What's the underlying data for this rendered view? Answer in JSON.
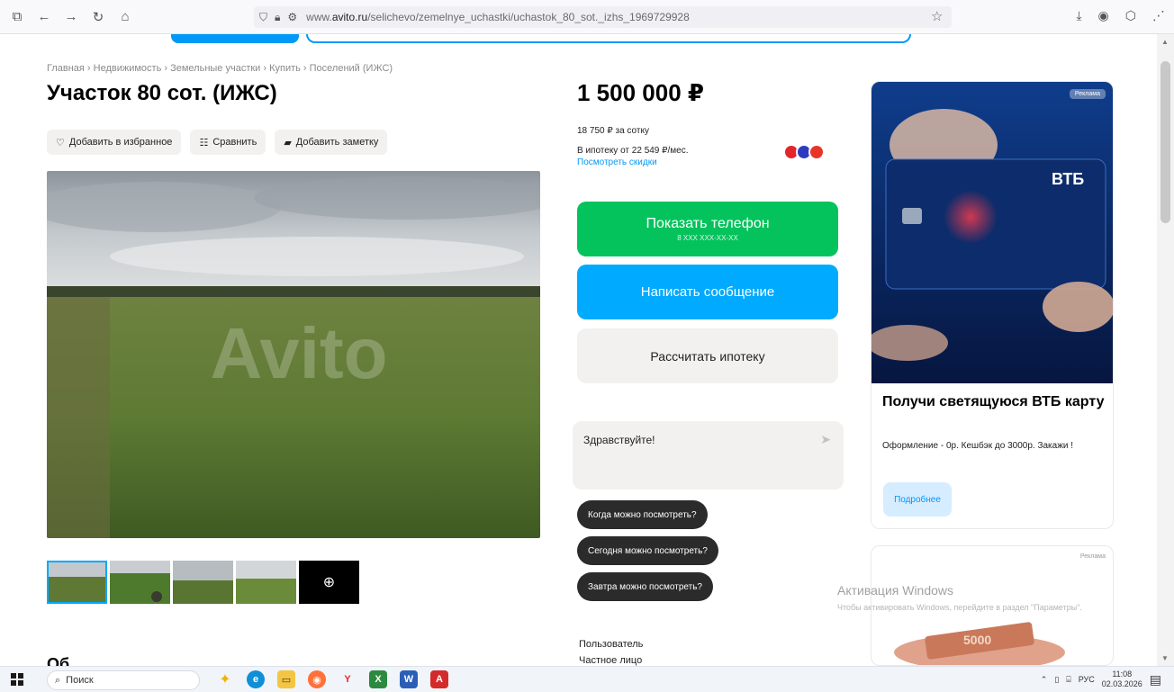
{
  "browser": {
    "url_prefix": "www.",
    "url_domain": "avito.ru",
    "url_path": "/selichevo/zemelnye_uchastki/uchastok_80_sot._izhs_1969729928"
  },
  "breadcrumbs": "Главная › Недвижимость › Земельные участки › Купить › Поселений (ИЖС)",
  "listing": {
    "title": "Участок 80 сот. (ИЖС)",
    "actions": {
      "favorite": "Добавить в избранное",
      "compare": "Сравнить",
      "note": "Добавить заметку"
    },
    "more_photos_icon": "more-photos-icon",
    "section_title_cut": "Об"
  },
  "sidebar": {
    "price": "1 500 000 ₽",
    "per_unit": "18 750 ₽ за сотку",
    "mortgage": "В ипотеку от 22 549 ₽/мес.",
    "discount_link": "Посмотреть скидки",
    "show_phone": "Показать телефон",
    "phone_mask": "8 XXX XXX-XX-XX",
    "write_message": "Написать сообщение",
    "calc_mortgage": "Рассчитать ипотеку",
    "chat_placeholder": "Здравствуйте!",
    "chips": [
      "Когда можно посмотреть?",
      "Сегодня можно посмотреть?",
      "Завтра можно посмотреть?"
    ],
    "seller_label": "Пользователь",
    "seller_type": "Частное лицо"
  },
  "ads": {
    "badge": "Реклама",
    "card_brand": "ВТБ",
    "title": "Получи светящуюся ВТБ карту",
    "desc": "Оформление - 0р. Кешбэк до 3000р. Закажи !",
    "button": "Подробнее",
    "badge2": "Реклама",
    "banknote_text": "5000"
  },
  "watermark": {
    "title": "Активация Windows",
    "subtitle": "Чтобы активировать Windows, перейдите в раздел \"Параметры\"."
  },
  "taskbar": {
    "search": "Поиск",
    "lang": "РУС",
    "time": "11:08",
    "date": "02.03.2026"
  },
  "colors": {
    "green": "#04c35c",
    "blue": "#00aaff",
    "link": "#0099f7",
    "grey_btn": "#f2f1f0"
  }
}
